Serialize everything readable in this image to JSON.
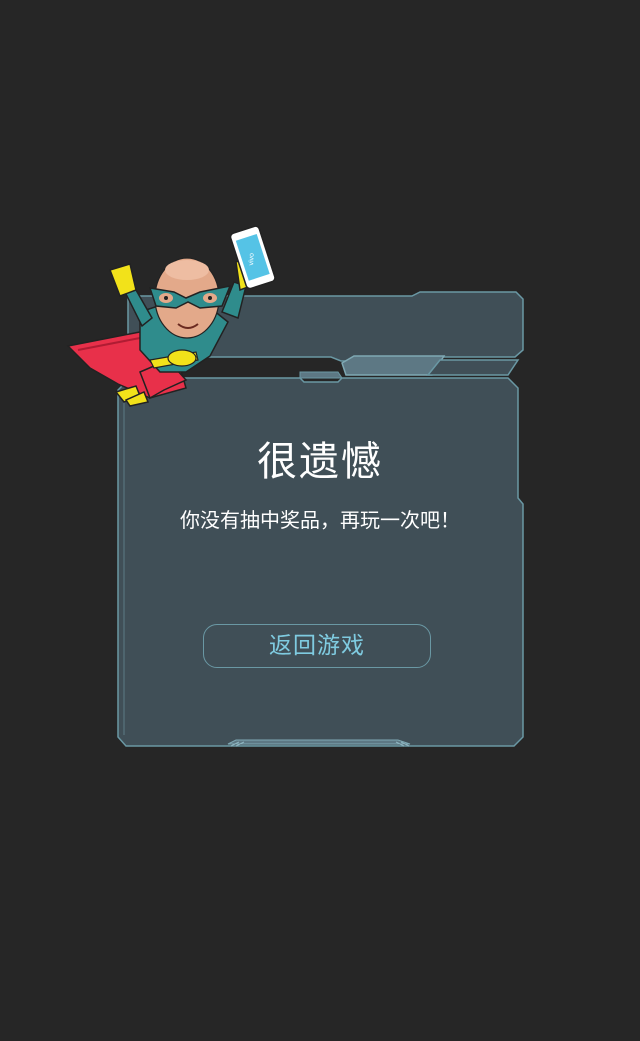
{
  "dialog": {
    "title": "很遗憾",
    "message": "你没有抽中奖品，再玩一次吧！",
    "button_label": "返回游戏"
  },
  "mascot": {
    "phone_brand": "vivo"
  },
  "colors": {
    "background": "#262626",
    "panel_fill": "#404f57",
    "panel_border": "#6a98a4",
    "button_text": "#7fcbe0",
    "text": "#ffffff"
  }
}
